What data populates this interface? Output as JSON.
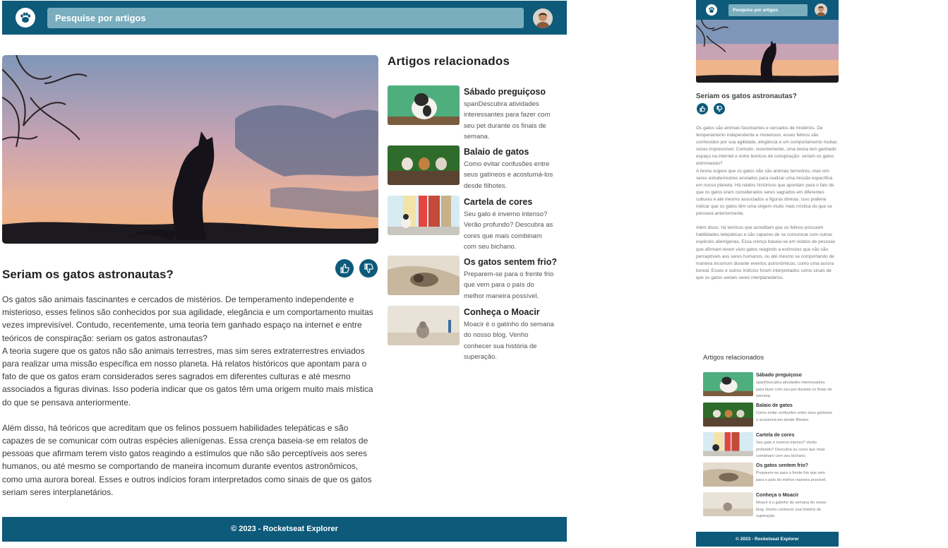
{
  "header": {
    "logo_icon": "paw-icon",
    "search_placeholder": "Pesquise por artigos",
    "avatar_icon": "user-avatar"
  },
  "article": {
    "title": "Seriam os gatos astronautas?",
    "like_icon": "thumbs-up-icon",
    "dislike_icon": "thumbs-down-icon",
    "paragraphs": [
      "Os gatos são animais fascinantes e cercados de mistérios. De temperamento independente e misterioso, esses felinos são conhecidos por sua agilidade, elegância e um comportamento muitas vezes imprevisível. Contudo, recentemente, uma teoria tem ganhado espaço na internet e entre teóricos de conspiração: seriam os gatos astronautas?\nA teoria sugere que os gatos não são animais terrestres, mas sim seres extraterrestres enviados para realizar uma missão específica em nosso planeta. Há relatos históricos que apontam para o fato de que os gatos eram considerados seres sagrados em diferentes culturas e até mesmo associados a figuras divinas. Isso poderia indicar que os gatos têm uma origem muito mais mística do que se pensava anteriormente.",
      "Além disso, há teóricos que acreditam que os felinos possuem habilidades telepáticas e são capazes de se comunicar com outras espécies alienígenas. Essa crença baseia-se em relatos de pessoas que afirmam terem visto gatos reagindo a estímulos que não são perceptíveis aos seres humanos, ou até mesmo se comportando de maneira incomum durante eventos astronômicos, como uma aurora boreal. Esses e outros indícios foram interpretados como sinais de que os gatos seriam seres interplanetários."
    ]
  },
  "related": {
    "heading": "Artigos relacionados",
    "items": [
      {
        "title": "Sábado preguiçoso",
        "desc": "spanDescubra atividades interessantes para fazer com seu pet durante os finais de semana."
      },
      {
        "title": "Balaio de gatos",
        "desc": "Como evitar confusões entre seus gatíneos e acostumá-los desde filhotes."
      },
      {
        "title": "Cartela de cores",
        "desc": "Seu gato é inverno intenso? Verão profundo? Descubra as cores que mais combinam com seu bichano."
      },
      {
        "title": "Os gatos sentem frio?",
        "desc": "Preparem-se para o frente frio que vem para o país do melhor maneira possível."
      },
      {
        "title": "Conheça o Moacir",
        "desc": "Moacir é o gatinho do semana do nosso blog. Venho conhecer sua história de superação."
      }
    ]
  },
  "footer": {
    "text": "© 2023 - Rocketseat Explorer"
  },
  "colors": {
    "primary": "#0d5a7a",
    "search_bg": "#7aaebf"
  }
}
